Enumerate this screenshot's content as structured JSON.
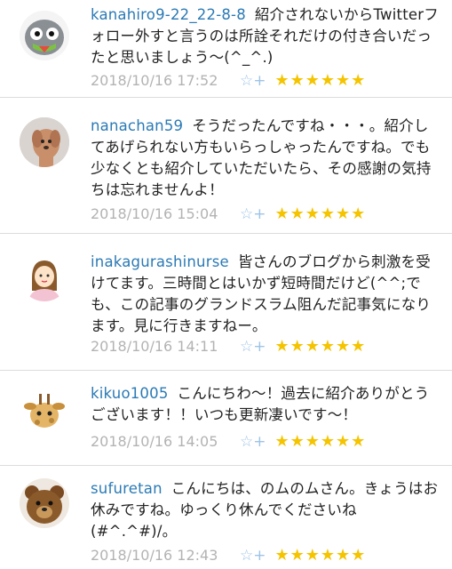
{
  "comments": [
    {
      "username": "kanahiro9-22_22-8-8",
      "text": "紹介されないからTwitterフォロー外すと言うのは所詮それだけの付き合いだったと思いましょう〜(^_^.)",
      "timestamp": "2018/10/16 17:52",
      "stars": "★★★★★★",
      "avatar": "robot-avatar"
    },
    {
      "username": "nanachan59",
      "text": "そうだったんですね・・・。紹介してあげられない方もいらっしゃったんですね。でも少なくとも紹介していただいたら、その感謝の気持ちは忘れませんよ！",
      "timestamp": "2018/10/16 15:04",
      "stars": "★★★★★★",
      "avatar": "dog-avatar"
    },
    {
      "username": "inakagurashinurse",
      "text": "皆さんのブログから刺激を受けてます。三時間とはいかず短時間だけど(^^;でも、この記事のグランドスラム阻んだ記事気になります。見に行きますねー。",
      "timestamp": "2018/10/16 14:11",
      "stars": "★★★★★★",
      "avatar": "nurse-avatar"
    },
    {
      "username": "kikuo1005",
      "text": "こんにちわ〜！過去に紹介ありがとうございます！！いつも更新凄いです〜！",
      "timestamp": "2018/10/16 14:05",
      "stars": "★★★★★★",
      "avatar": "giraffe-avatar"
    },
    {
      "username": "sufuretan",
      "text": "こんにちは、のムのムさん。きょうはお休みですね。ゆっくり休んでくださいね(#^.^#)/。",
      "timestamp": "2018/10/16 12:43",
      "stars": "★★★★★★",
      "avatar": "teddy-bear-avatar"
    }
  ],
  "add_star_icon": "☆+",
  "colors": {
    "username": "#2b7ab5",
    "star": "#f5c400",
    "add_star": "#9ec3e6",
    "meta": "#b3b3b3"
  }
}
